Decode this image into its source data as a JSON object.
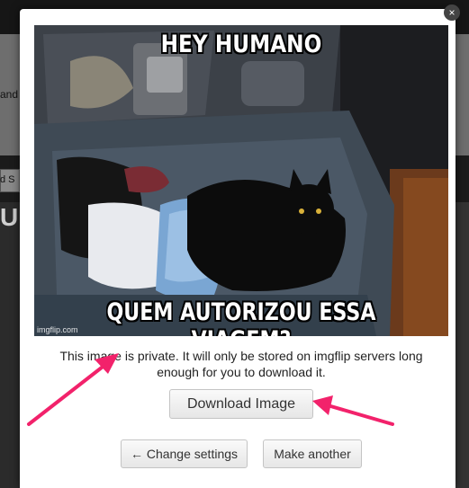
{
  "background": {
    "fragment_1": "and",
    "fragment_2": "d S",
    "fragment_3": "U"
  },
  "modal": {
    "close_icon": "×",
    "meme": {
      "top_text": "HEY HUMANO",
      "bottom_text": "QUEM AUTORIZOU ESSA VIAGEM?",
      "watermark": "imgflip.com"
    },
    "privacy_note": "This image is private. It will only be stored on imgflip servers long enough for you to download it.",
    "download_label": "Download Image",
    "change_settings_label": "← Change settings",
    "make_another_label": "Make another"
  },
  "colors": {
    "arrow": "#f2226b",
    "modal_bg": "#ffffff",
    "button_border": "#c4c4c4"
  }
}
